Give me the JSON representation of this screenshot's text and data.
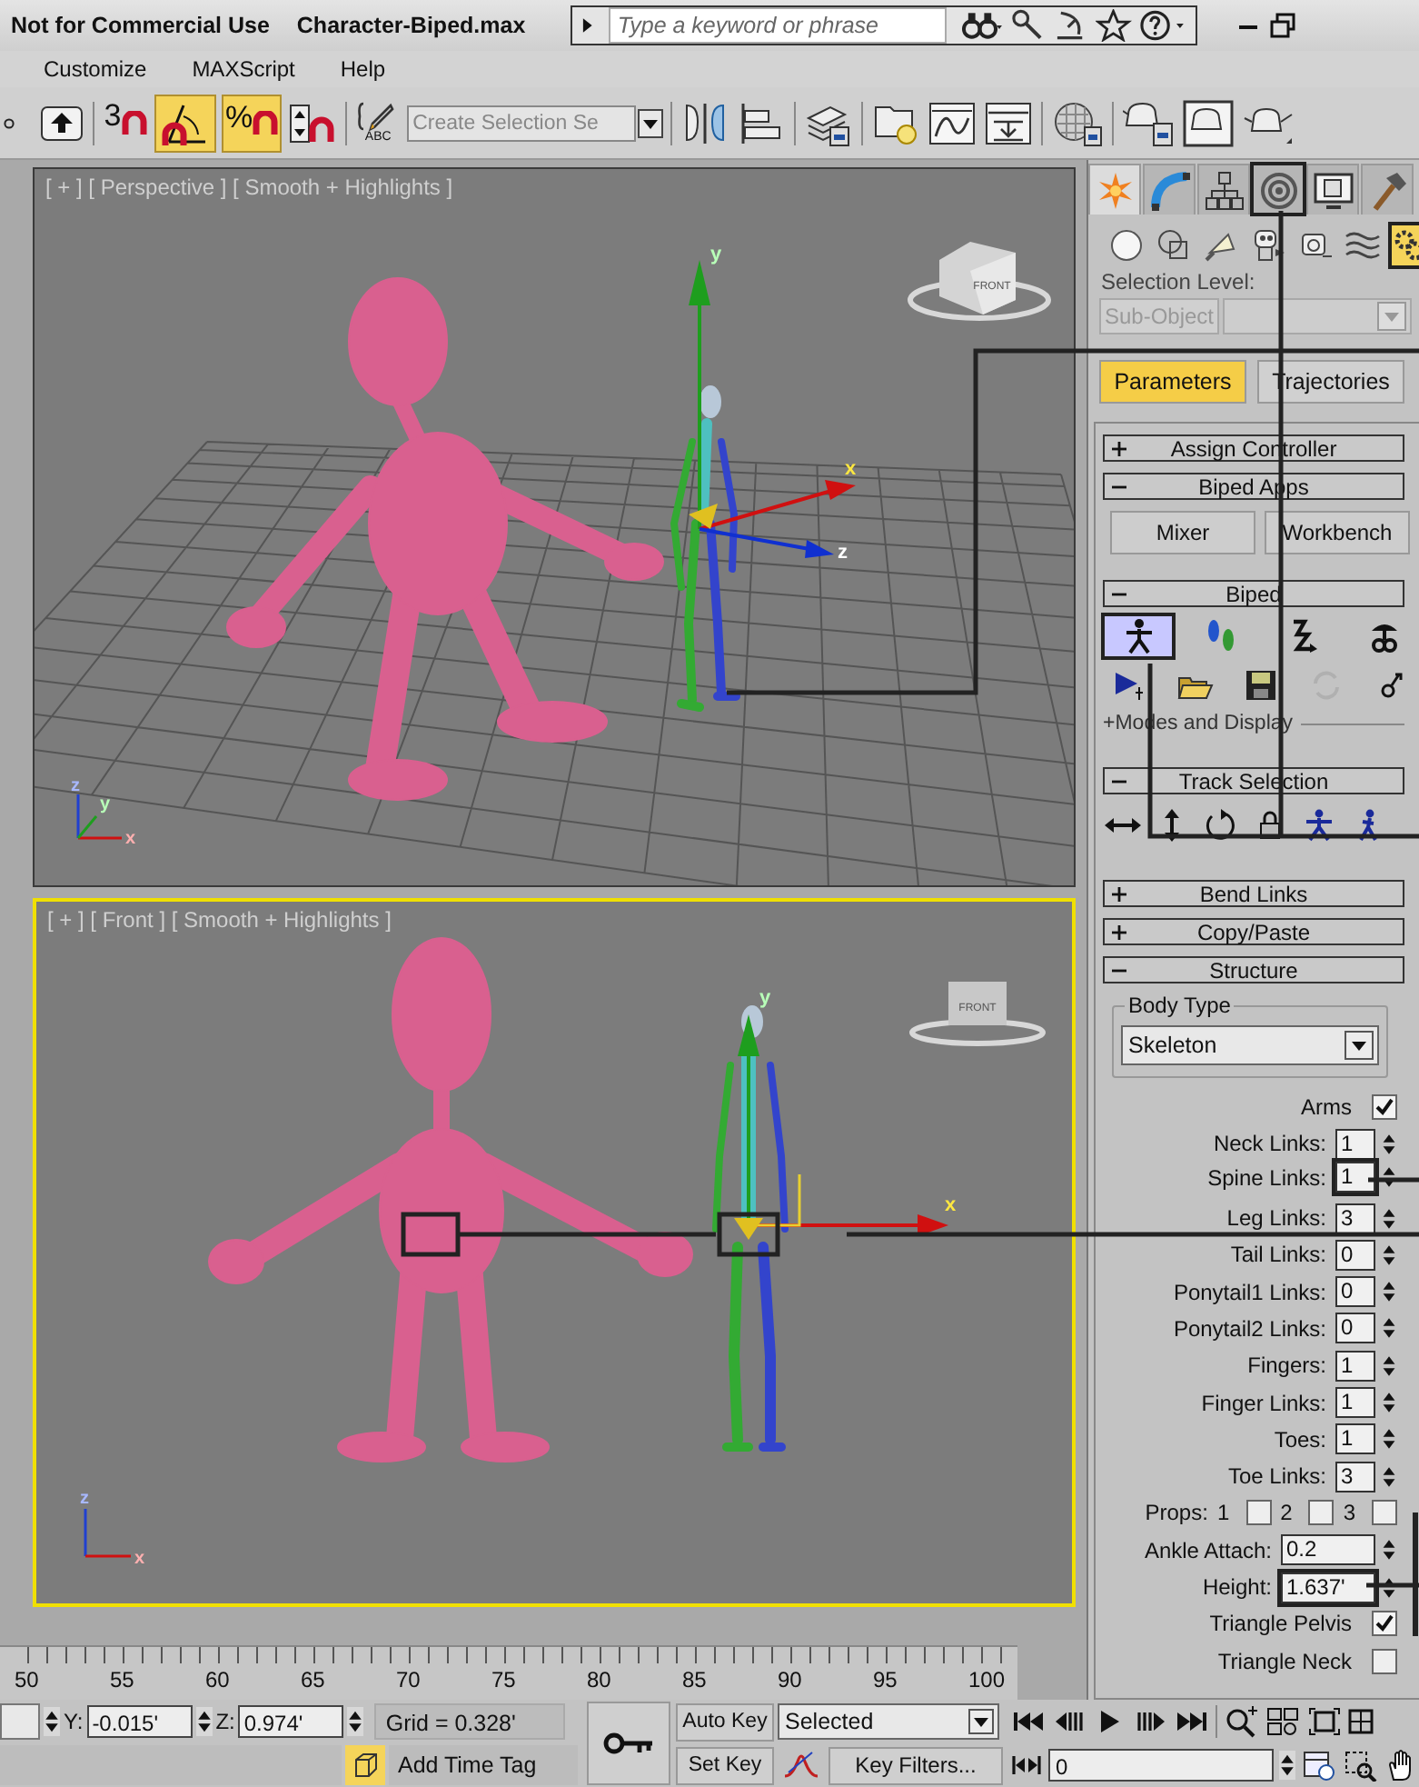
{
  "title_bar": {
    "notice": "Not for Commercial Use",
    "document": "Character-Biped.max"
  },
  "search": {
    "placeholder": "Type a keyword or phrase"
  },
  "menu": [
    "Customize",
    "MAXScript",
    "Help"
  ],
  "toolbar": [
    {
      "kind": "select",
      "on": false
    },
    {
      "kind": "snap",
      "label": "3",
      "on": false
    },
    {
      "kind": "angle",
      "on": true
    },
    {
      "kind": "percent",
      "label": "%",
      "on": true
    },
    {
      "kind": "spinner",
      "on": false
    },
    {
      "kind": "named",
      "label": "ABC",
      "on": false
    },
    {
      "kind": "selset",
      "placeholder": "Create Selection Se"
    },
    {
      "kind": "mirror",
      "on": false
    },
    {
      "kind": "align",
      "on": false
    },
    {
      "kind": "layers",
      "on": false
    },
    {
      "kind": "explorer",
      "on": false
    },
    {
      "kind": "curve",
      "on": false
    },
    {
      "kind": "schematic",
      "on": false
    },
    {
      "kind": "material",
      "on": false
    },
    {
      "kind": "render-setup",
      "on": false
    },
    {
      "kind": "frame",
      "on": false
    },
    {
      "kind": "teapot",
      "on": false
    }
  ],
  "viewports": [
    {
      "kind": "perspective",
      "label": "[ + ] [ Perspective ] [ Smooth + Highlights ]",
      "selected": false,
      "cube": "FRONT",
      "gizmo": [
        "y",
        "x",
        "z"
      ],
      "corner_axes": [
        "z",
        "y",
        "x"
      ]
    },
    {
      "kind": "front",
      "label": "[ + ] [ Front ] [ Smooth + Highlights ]",
      "selected": true,
      "cube": "FRONT",
      "gizmo": [
        "y",
        "x"
      ],
      "corner_axes": [
        "z",
        "x"
      ]
    }
  ],
  "command_panel": {
    "tabs": [
      {
        "kind": "create",
        "selected": true,
        "callout": false
      },
      {
        "kind": "modify",
        "selected": false,
        "callout": false
      },
      {
        "kind": "hierarchy",
        "selected": false,
        "callout": false
      },
      {
        "kind": "motion",
        "selected": false,
        "callout": true
      },
      {
        "kind": "display",
        "selected": false,
        "callout": false
      },
      {
        "kind": "utilities",
        "selected": false,
        "callout": false
      }
    ],
    "categories": [
      {
        "kind": "geometry",
        "selected": false,
        "callout": false
      },
      {
        "kind": "shapes",
        "selected": false,
        "callout": false
      },
      {
        "kind": "lights",
        "selected": false,
        "callout": false
      },
      {
        "kind": "cameras",
        "selected": false,
        "callout": false
      },
      {
        "kind": "helpers",
        "selected": false,
        "callout": false
      },
      {
        "kind": "spacewarps",
        "selected": false,
        "callout": false
      },
      {
        "kind": "systems",
        "selected": true,
        "callout": true
      }
    ],
    "selection_level": {
      "label": "Selection Level:",
      "button": "Sub-Object",
      "disabled": true
    },
    "modes": [
      {
        "label": "Parameters",
        "selected": true
      },
      {
        "label": "Trajectories",
        "selected": false
      }
    ],
    "rollouts": [
      {
        "title": "Assign Controller",
        "expanded": false
      },
      {
        "title": "Biped Apps",
        "expanded": true,
        "kind": "apps",
        "buttons": [
          "Mixer",
          "Workbench"
        ]
      },
      {
        "title": "Biped",
        "expanded": true,
        "kind": "biped",
        "icons": [
          {
            "kind": "figure",
            "selected": true,
            "callout": true
          },
          {
            "kind": "footsteps",
            "selected": false,
            "callout": false
          },
          {
            "kind": "move-all",
            "selected": false,
            "callout": false
          },
          {
            "kind": "buffer",
            "selected": false,
            "callout": false
          }
        ],
        "icons2": [
          {
            "kind": "play",
            "disabled": false
          },
          {
            "kind": "open",
            "disabled": false
          },
          {
            "kind": "save",
            "disabled": false
          },
          {
            "kind": "refresh",
            "disabled": true
          },
          {
            "kind": "link",
            "disabled": false
          }
        ],
        "subrollout": "+Modes and Display"
      },
      {
        "title": "Track Selection",
        "expanded": true,
        "kind": "track",
        "icons": [
          {
            "kind": "horizontal"
          },
          {
            "kind": "vertical"
          },
          {
            "kind": "rotate"
          },
          {
            "kind": "lock"
          },
          {
            "kind": "figure"
          },
          {
            "kind": "figure-walk"
          }
        ]
      },
      {
        "title": "Bend Links",
        "expanded": false
      },
      {
        "title": "Copy/Paste",
        "expanded": false
      },
      {
        "title": "Structure",
        "expanded": true,
        "kind": "structure",
        "body_type": {
          "label": "Body Type",
          "value": "Skeleton"
        },
        "rows": [
          {
            "kind": "check",
            "label": "Arms",
            "checked": true
          },
          {
            "kind": "spin",
            "label": "Neck Links:",
            "value": "1",
            "callout": false
          },
          {
            "kind": "spin",
            "label": "Spine Links:",
            "value": "1",
            "callout": true
          },
          {
            "kind": "spin",
            "label": "Leg Links:",
            "value": "3",
            "callout": false
          },
          {
            "kind": "spin",
            "label": "Tail Links:",
            "value": "0",
            "callout": false
          },
          {
            "kind": "spin",
            "label": "Ponytail1 Links:",
            "value": "0",
            "callout": false
          },
          {
            "kind": "spin",
            "label": "Ponytail2 Links:",
            "value": "0",
            "callout": false
          },
          {
            "kind": "spin",
            "label": "Fingers:",
            "value": "1",
            "callout": false
          },
          {
            "kind": "spin",
            "label": "Finger Links:",
            "value": "1",
            "callout": false
          },
          {
            "kind": "spin",
            "label": "Toes:",
            "value": "1",
            "callout": false
          },
          {
            "kind": "spin",
            "label": "Toe Links:",
            "value": "3",
            "callout": false
          },
          {
            "kind": "props",
            "label": "Props:",
            "items": [
              {
                "label": "1",
                "checked": false
              },
              {
                "label": "2",
                "checked": false
              },
              {
                "label": "3",
                "checked": false
              }
            ]
          },
          {
            "kind": "spinwide",
            "label": "Ankle Attach:",
            "value": "0.2",
            "callout": false
          },
          {
            "kind": "spinwide",
            "label": "Height:",
            "value": "1.637'",
            "callout": true
          },
          {
            "kind": "check",
            "label": "Triangle Pelvis",
            "checked": true
          },
          {
            "kind": "check",
            "label": "Triangle Neck",
            "checked": false
          }
        ]
      }
    ]
  },
  "timeline": {
    "labels": [
      "50",
      "55",
      "60",
      "65",
      "70",
      "75",
      "80",
      "85",
      "90",
      "95",
      "100"
    ]
  },
  "status": {
    "y_label": "Y:",
    "y": "-0.015'",
    "z_label": "Z:",
    "z": "0.974'",
    "grid": "Grid = 0.328'",
    "time_tag": "Add Time Tag",
    "auto_key": "Auto Key",
    "auto_key_on": false,
    "key_mode": "Selected",
    "set_key": "Set Key",
    "key_filters": "Key Filters...",
    "frame": "0"
  }
}
